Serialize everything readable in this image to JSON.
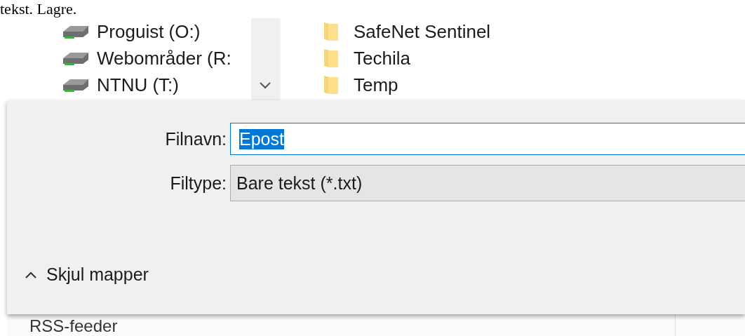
{
  "caption_text": "tekst. Lagre.",
  "navigation_pane": {
    "items": [
      {
        "label": "Proguist (O:)"
      },
      {
        "label": "Webområder (R:"
      },
      {
        "label": "NTNU (T:)"
      }
    ]
  },
  "file_list": {
    "items": [
      {
        "label": "SafeNet Sentinel"
      },
      {
        "label": "Techila"
      },
      {
        "label": "Temp"
      }
    ]
  },
  "form": {
    "filename": {
      "label": "Filnavn:",
      "value": "Epost",
      "selected": true
    },
    "filetype": {
      "label": "Filtype:",
      "value": "Bare tekst (*.txt)"
    }
  },
  "toggle_folders": {
    "label": "Skjul mapper",
    "expanded": true
  },
  "background_window": {
    "items": [
      {
        "label": "RSS-feeder"
      }
    ]
  }
}
